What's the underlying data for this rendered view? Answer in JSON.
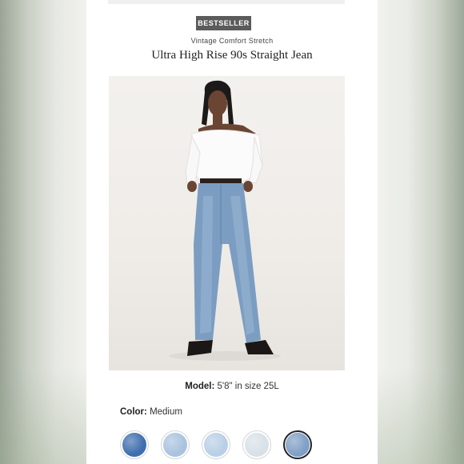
{
  "product": {
    "badge": "BESTSELLER",
    "subtitle": "Vintage Comfort Stretch",
    "title": "Ultra High Rise 90s Straight Jean",
    "image_alt": "Model wearing white off-shoulder top and medium wash straight jeans"
  },
  "model_info": {
    "label": "Model:",
    "value": "5'8\" in size 25L"
  },
  "color": {
    "label": "Color:",
    "value": "Medium"
  },
  "swatches": [
    {
      "name": "dark-wash",
      "color": "#3f6fae",
      "selected": false
    },
    {
      "name": "light-wash",
      "color": "#a9c3de",
      "selected": false
    },
    {
      "name": "light-blue-wash",
      "color": "#b9cfe6",
      "selected": false
    },
    {
      "name": "bleach-wash",
      "color": "#d8e1e8",
      "selected": false
    },
    {
      "name": "medium-wash",
      "color": "#7f9fc6",
      "selected": true
    }
  ],
  "colors": {
    "badge_bg": "#5b5b5b",
    "card_bg": "#ffffff",
    "selected_border": "#222222"
  }
}
